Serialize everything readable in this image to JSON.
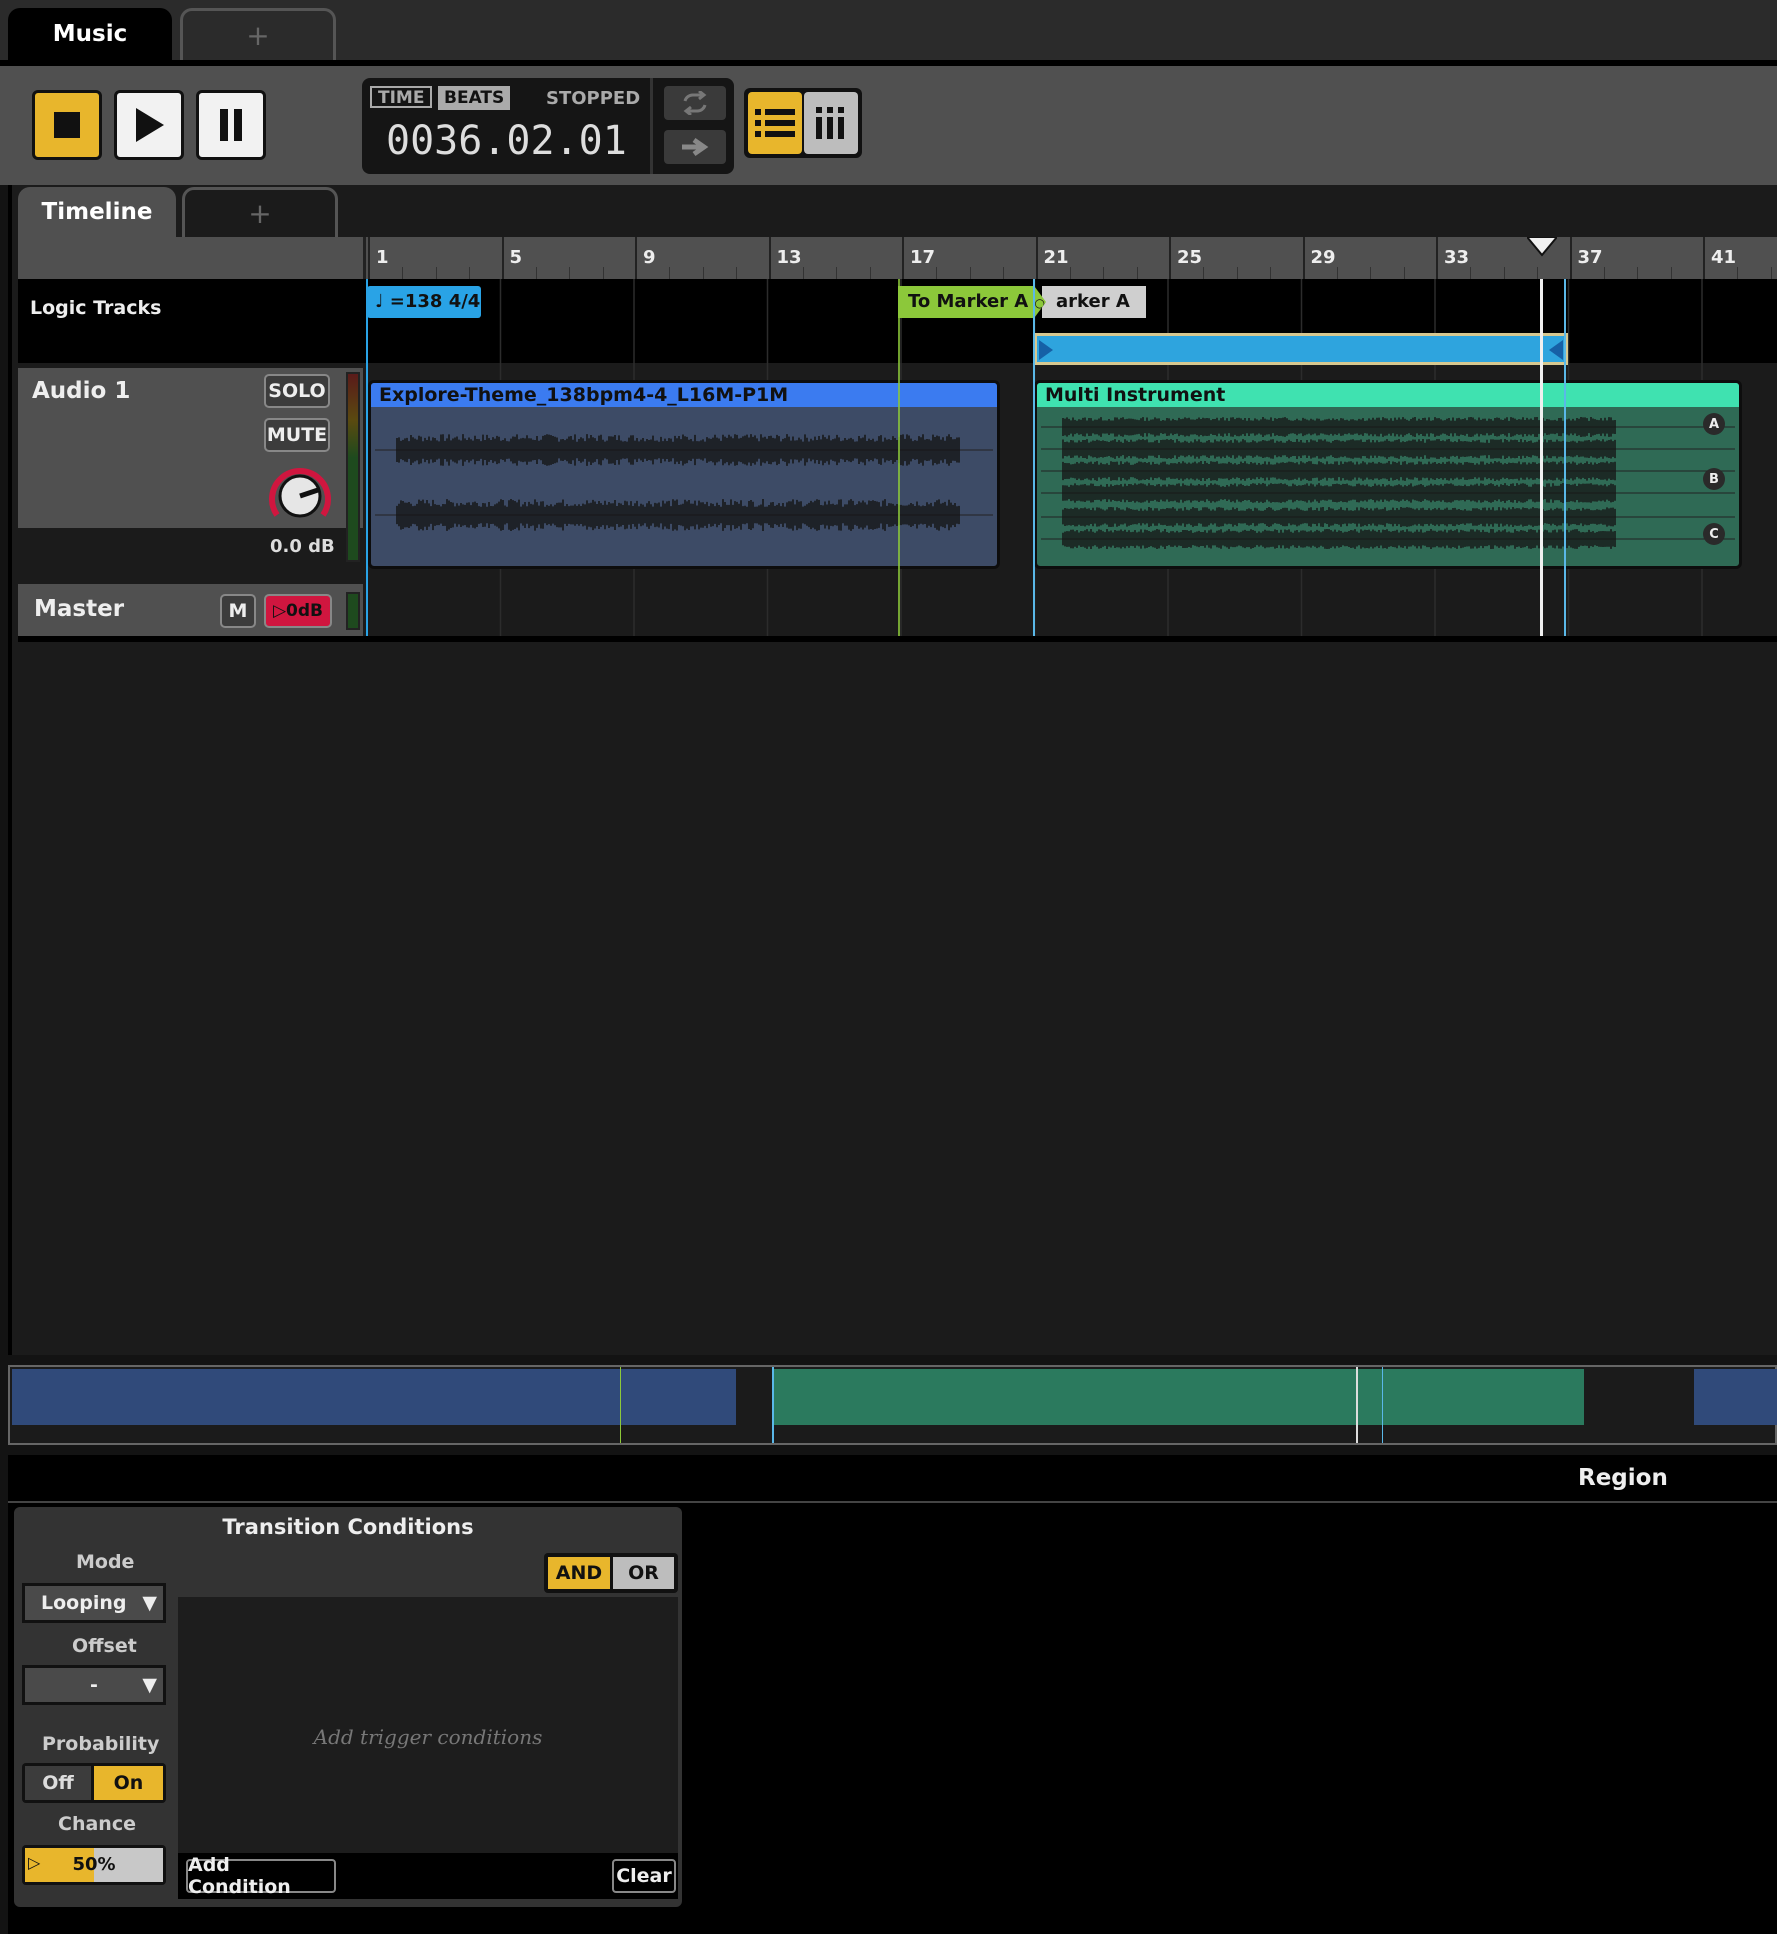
{
  "app": {
    "tabs": [
      {
        "label": "Music",
        "active": true
      },
      {
        "label": "+",
        "active": false
      }
    ]
  },
  "transport": {
    "time_tag": "TIME",
    "beats_tag": "BEATS",
    "status": "STOPPED",
    "position": "0036.02.01",
    "buttons": [
      "stop",
      "play",
      "pause"
    ]
  },
  "editor_tabs": [
    {
      "label": "Timeline",
      "active": true
    },
    {
      "label": "+",
      "active": false
    }
  ],
  "ruler": {
    "ticks": [
      "1",
      "5",
      "9",
      "13",
      "17",
      "21",
      "25",
      "29",
      "33",
      "37",
      "41"
    ],
    "playhead_bar": 36
  },
  "tracks": {
    "logic": {
      "label": "Logic Tracks",
      "tempo_marker": "=138 4/4",
      "transition_marker": "To Marker A",
      "destination_marker": "arker A"
    },
    "audio1": {
      "label": "Audio 1",
      "solo": "SOLO",
      "mute": "MUTE",
      "volume": "0.0 dB",
      "clip1": {
        "name": "Explore-Theme_138bpm4-4_L16M-P1M",
        "color": "#3b7bf0"
      },
      "clip2": {
        "name": "Multi Instrument",
        "color": "#3fe2b0",
        "playlist": [
          "A",
          "B",
          "C"
        ]
      }
    },
    "master": {
      "label": "Master",
      "mute": "M",
      "volume": "0dB"
    }
  },
  "region": {
    "title": "Region",
    "transition_conditions": {
      "title": "Transition Conditions",
      "mode_label": "Mode",
      "mode_value": "Looping",
      "offset_label": "Offset",
      "offset_value": "-",
      "probability_label": "Probability",
      "probability_off": "Off",
      "probability_on": "On",
      "chance_label": "Chance",
      "chance_value": "50%",
      "chance_fraction": 0.5,
      "logic_and": "AND",
      "logic_or": "OR",
      "placeholder": "Add trigger conditions",
      "add_button": "Add Condition",
      "clear_button": "Clear"
    }
  },
  "colors": {
    "accent": "#e8b62c",
    "tempo": "#29a3e6",
    "transition": "#8cc83a",
    "loop": "#2ea4de",
    "clip1": "#3b7bf0",
    "clip2": "#3fe2b0"
  }
}
